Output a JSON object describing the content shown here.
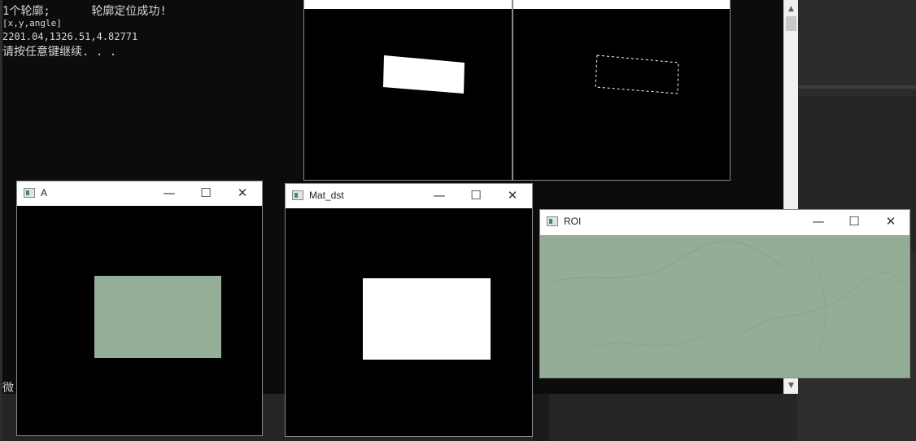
{
  "console": {
    "lines": [
      "1个轮廓;      轮廓定位成功!",
      "[x,y,angle]",
      "2201.04,1326.51,4.82771",
      "请按任意键继续. . ."
    ],
    "side_text": "微"
  },
  "windows": {
    "a": {
      "title": "A"
    },
    "mat_dst": {
      "title": "Mat_dst"
    },
    "roi": {
      "title": "ROI"
    }
  },
  "controls": {
    "minimize": "—",
    "maximize": "☐",
    "close": "✕"
  },
  "scrollbar": {
    "up": "▲",
    "down": "▼"
  },
  "colors": {
    "roi_green": "#93ad97",
    "console_bg": "#0c0c0c"
  }
}
